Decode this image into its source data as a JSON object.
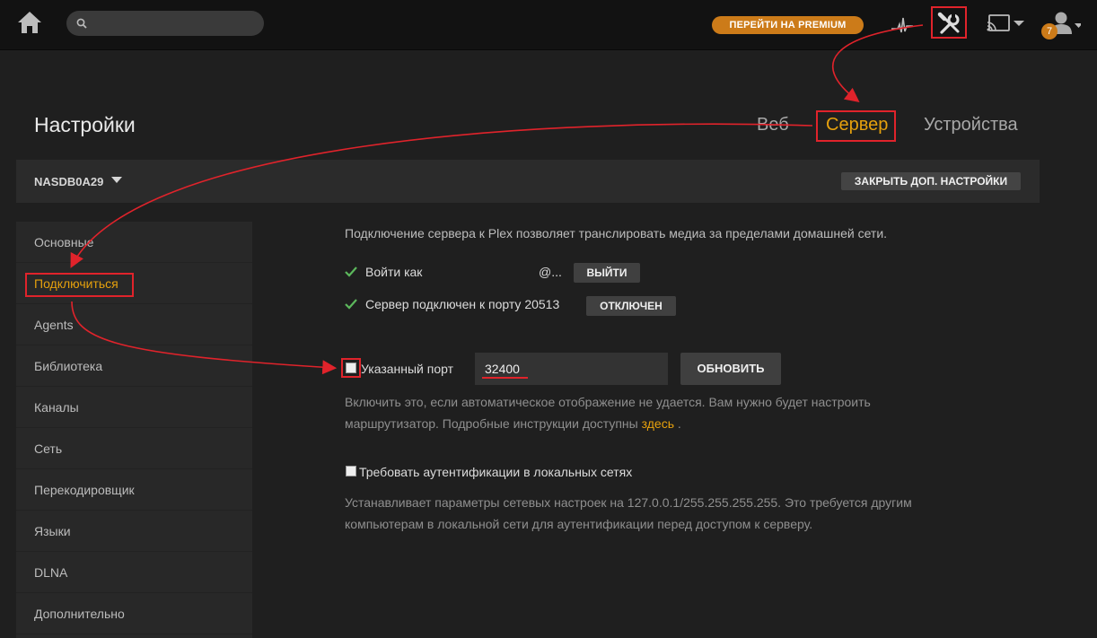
{
  "topbar": {
    "search_placeholder": "",
    "premium_label": "ПЕРЕЙТИ НА PREMIUM",
    "badge_count": "7",
    "icons": [
      "home-icon",
      "search-icon",
      "activity-icon",
      "settings-icon",
      "cast-icon",
      "user-icon"
    ]
  },
  "header": {
    "title": "Настройки",
    "tabs": [
      "Веб",
      "Сервер",
      "Устройства"
    ],
    "active_tab": "Сервер"
  },
  "server_bar": {
    "name": "NASDB0A29",
    "advanced_label": "ЗАКРЫТЬ ДОП. НАСТРОЙКИ"
  },
  "sidebar": {
    "items": [
      "Основные",
      "Подключиться",
      "Agents",
      "Библиотека",
      "Каналы",
      "Сеть",
      "Перекодировщик",
      "Языки",
      "DLNA",
      "Дополнительно"
    ],
    "active": "Подключиться"
  },
  "main": {
    "intro": "Подключение сервера к Plex позволяет транслировать медиа за пределами домашней сети.",
    "signed_in_label": "Войти как",
    "signed_in_value": "@...",
    "signout_label": "ВЫЙТИ",
    "port_status_label": "Сервер подключен к порту 20513",
    "disable_label": "ОТКЛЮЧЕН",
    "manual_port_label": "Указанный порт",
    "port_value": "32400",
    "update_label": "ОБНОВИТЬ",
    "port_help_line1": "Включить это, если автоматическое отображение не удается. Вам нужно будет настроить",
    "port_help_line2": "маршрутизатор. Подробные инструкции доступны",
    "port_help_link": "здесь",
    "port_help_end": ".",
    "auth_label": "Требовать аутентификации в локальных сетях",
    "auth_help_line1": "Устанавливает параметры сетевых настроек на 127.0.0.1/255.255.255.255. Это требуется другим",
    "auth_help_line2": "компьютерам в локальной сети для аутентификации перед доступом к серверу."
  },
  "colors": {
    "accent": "#e5a00d",
    "premium": "#cc7b19",
    "annotation": "#e0232b",
    "check": "#5cb85c"
  }
}
